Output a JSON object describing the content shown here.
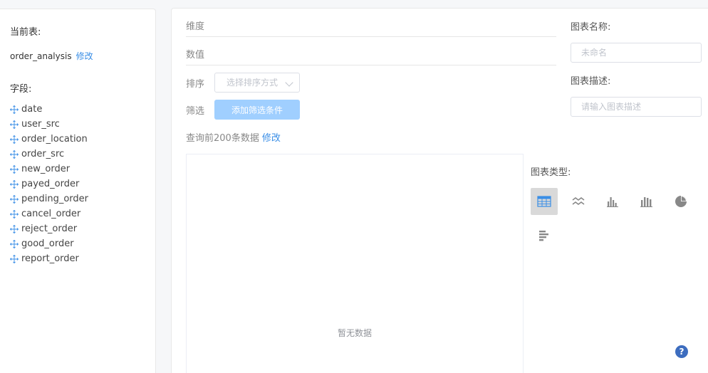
{
  "sidebar": {
    "current_table_label": "当前表:",
    "table_name": "order_analysis",
    "edit_link": "修改",
    "fields_label": "字段:",
    "fields": [
      "date",
      "user_src",
      "order_location",
      "order_src",
      "new_order",
      "payed_order",
      "pending_order",
      "cancel_order",
      "reject_order",
      "good_order",
      "report_order"
    ]
  },
  "main": {
    "dimension_label": "维度",
    "value_label": "数值",
    "sort_label": "排序",
    "sort_placeholder": "选择排序方式",
    "filter_label": "筛选",
    "add_filter_button": "添加筛选条件",
    "query_text": "查询前200条数据",
    "query_edit_link": "修改",
    "empty_text": "暂无数据"
  },
  "right": {
    "chart_name_label": "图表名称:",
    "chart_name_placeholder": "未命名",
    "chart_desc_label": "图表描述:",
    "chart_desc_placeholder": "请输入图表描述",
    "chart_type_label": "图表类型:",
    "chart_types": [
      "table-icon",
      "line-chart-icon",
      "bar-chart-icon",
      "column-chart-icon",
      "pie-chart-icon",
      "horizontal-bar-chart-icon"
    ],
    "active_chart_type": "table-icon"
  },
  "help": {
    "label": "?"
  },
  "colors": {
    "link": "#3a8ee6",
    "button_disabled": "#a0cfff",
    "help": "#3d6dbf"
  }
}
